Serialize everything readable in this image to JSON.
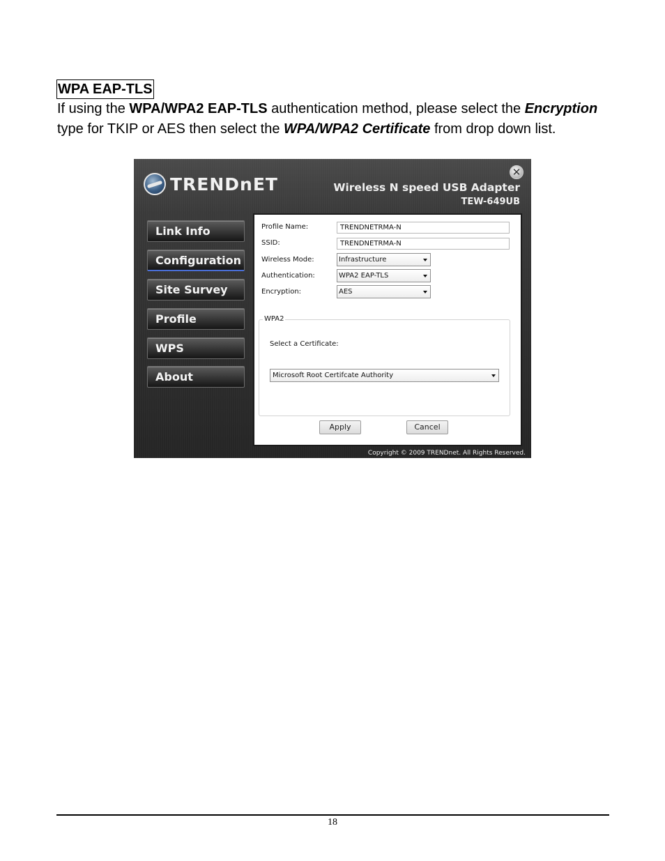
{
  "heading": "WPA EAP-TLS",
  "paragraph": {
    "t1": "If using the ",
    "b1": "WPA/WPA2 EAP-TLS",
    "t2": " authentication method, please select the ",
    "b2": "Encryption",
    "t3": " type for TKIP or AES then select the ",
    "b3": "WPA/WPA2 Certificate",
    "t4": " from drop down list."
  },
  "app": {
    "logo_text": "TRENDnET",
    "close_glyph": "✕",
    "product_name": "Wireless N speed USB Adapter",
    "product_model": "TEW-649UB",
    "nav": [
      {
        "label": "Link Info",
        "active": false
      },
      {
        "label": "Configuration",
        "active": true
      },
      {
        "label": "Site Survey",
        "active": false
      },
      {
        "label": "Profile",
        "active": false
      },
      {
        "label": "WPS",
        "active": false
      },
      {
        "label": "About",
        "active": false
      }
    ],
    "form": {
      "profile_name_label": "Profile Name:",
      "profile_name_value": "TRENDNETRMA-N",
      "ssid_label": "SSID:",
      "ssid_value": "TRENDNETRMA-N",
      "wireless_mode_label": "Wireless Mode:",
      "wireless_mode_value": "Infrastructure",
      "authentication_label": "Authentication:",
      "authentication_value": "WPA2 EAP-TLS",
      "encryption_label": "Encryption:",
      "encryption_value": "AES"
    },
    "group": {
      "legend": "WPA2",
      "cert_label": "Select a Certificate:",
      "cert_value": "Microsoft Root Certifcate Authority"
    },
    "apply_label": "Apply",
    "cancel_label": "Cancel",
    "copyright": "Copyright © 2009 TRENDnet. All Rights Reserved."
  },
  "footer": {
    "page_number": "18"
  },
  "colors": {
    "window_bg": "#2e2e2e",
    "active_underline": "#4a6fd8",
    "panel_bg": "#ffffff"
  },
  "icons": [
    "trendnet-logo-icon",
    "close-icon",
    "dropdown-arrow-icon"
  ]
}
